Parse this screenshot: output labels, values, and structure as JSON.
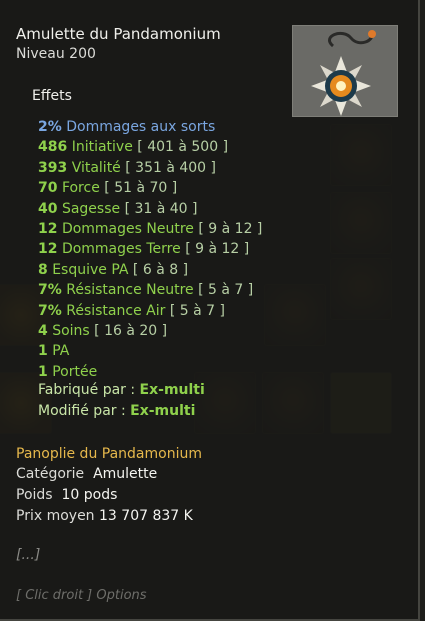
{
  "item": {
    "name": "Amulette du Pandamonium",
    "level": "Niveau  200"
  },
  "effects_header": "Effets",
  "effects": [
    {
      "value": "2%",
      "name": "Dommages aux sorts",
      "range": "",
      "style": "blue"
    },
    {
      "value": "486",
      "name": "Initiative",
      "range": "[ 401 à 500 ]",
      "style": "green"
    },
    {
      "value": "393",
      "name": "Vitalité",
      "range": "[ 351 à 400 ]",
      "style": "green"
    },
    {
      "value": "70",
      "name": "Force",
      "range": "[ 51 à 70 ]",
      "style": "green"
    },
    {
      "value": "40",
      "name": "Sagesse",
      "range": "[ 31 à 40 ]",
      "style": "green"
    },
    {
      "value": "12",
      "name": "Dommages Neutre",
      "range": "[ 9 à 12 ]",
      "style": "green"
    },
    {
      "value": "12",
      "name": "Dommages Terre",
      "range": "[ 9 à 12 ]",
      "style": "green"
    },
    {
      "value": "8",
      "name": "Esquive PA",
      "range": "[ 6 à 8 ]",
      "style": "green"
    },
    {
      "value": "7%",
      "name": "Résistance Neutre",
      "range": "[ 5 à 7 ]",
      "style": "green"
    },
    {
      "value": "7%",
      "name": "Résistance Air",
      "range": "[ 5 à 7 ]",
      "style": "green"
    },
    {
      "value": "4",
      "name": "Soins",
      "range": "[ 16 à 20 ]",
      "style": "green"
    },
    {
      "value": "1",
      "name": "PA",
      "range": "",
      "style": "green"
    },
    {
      "value": "1",
      "name": "Portée",
      "range": "",
      "style": "green"
    }
  ],
  "crafted": {
    "label": "Fabriqué par :",
    "value": "Ex-multi"
  },
  "modified": {
    "label": "Modifié par :",
    "value": "Ex-multi"
  },
  "set_name": "Panoplie du Pandamonium",
  "info": {
    "category_label": "Catégorie",
    "category_value": "Amulette",
    "weight_label": "Poids",
    "weight_value": "10 pods",
    "price_label": "Prix moyen",
    "price_value": "13 707 837 K"
  },
  "ellipsis": "[...]",
  "hint": "[ Clic droit ] Options",
  "icons": {
    "item_image": "spiked-amulet-icon"
  }
}
